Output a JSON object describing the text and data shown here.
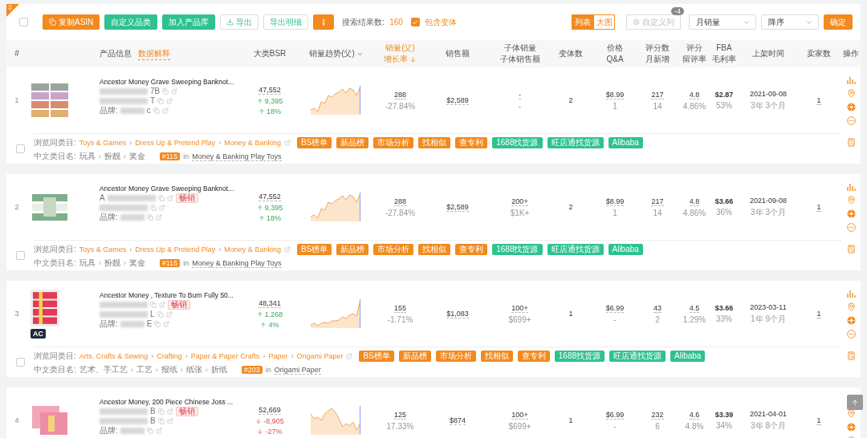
{
  "toolbar": {
    "select_all": {
      "checked": false
    },
    "buttons": [
      {
        "label": "复制ASIN",
        "kind": "primary"
      },
      {
        "label": "自定义品类",
        "kind": "success"
      },
      {
        "label": "加入产品库",
        "kind": "success"
      },
      {
        "label": "导出",
        "kind": "download"
      },
      {
        "label": "导出明细",
        "kind": "outline"
      }
    ],
    "more_button": "⋮",
    "result_label": "搜索结果数:",
    "result_count": "160",
    "include_variants": {
      "label": "包含变体",
      "checked": true
    },
    "view_tabs": [
      {
        "label": "列表",
        "selected": true
      },
      {
        "label": "大图",
        "selected": false
      }
    ],
    "custom_columns": {
      "label": "自定义列",
      "badge": "-4",
      "disabled": true
    },
    "sort_field": "月销量",
    "sort_order": "降序",
    "confirm": "确定"
  },
  "columns": [
    {
      "lines": [
        "#"
      ],
      "sorted": false,
      "kind": "plain"
    },
    {
      "lines": [
        "产品信息"
      ],
      "link": "数据解释",
      "sorted": false,
      "kind": "info"
    },
    {
      "lines": [
        "大类BSR"
      ],
      "sorted": false,
      "kind": "plain"
    },
    {
      "lines": [
        "销量趋势(父)"
      ],
      "sorted": false,
      "kind": "dropdown"
    },
    {
      "lines": [
        "销量(父)",
        "增长率"
      ],
      "sorted": true,
      "kind": "plain"
    },
    {
      "lines": [
        "销售额"
      ],
      "sorted": false,
      "kind": "plain"
    },
    {
      "lines": [
        "子体销量",
        "子体销售额"
      ],
      "sorted": false,
      "kind": "plain"
    },
    {
      "lines": [
        "变体数"
      ],
      "sorted": false,
      "kind": "plain"
    },
    {
      "lines": [
        "价格",
        "Q&A"
      ],
      "sorted": false,
      "kind": "plain"
    },
    {
      "lines": [
        "评分数",
        "月新增"
      ],
      "sorted": false,
      "kind": "plain"
    },
    {
      "lines": [
        "评分",
        "留评率"
      ],
      "sorted": false,
      "kind": "plain"
    },
    {
      "lines": [
        "FBA",
        "毛利率"
      ],
      "sorted": false,
      "kind": "plain"
    },
    {
      "lines": [
        "上架时间"
      ],
      "sorted": false,
      "kind": "plain"
    },
    {
      "lines": [
        "卖家数"
      ],
      "sorted": false,
      "kind": "plain"
    },
    {
      "lines": [
        "操作"
      ],
      "sorted": false,
      "kind": "plain"
    }
  ],
  "rows": [
    {
      "index": "1",
      "checked": false,
      "title": "Ancestor Money Grave Sweeping Banknot...",
      "asin": {
        "tail": "7B"
      },
      "parent": {
        "tail": "T"
      },
      "brand": {
        "label": "品牌:",
        "tail": "c"
      },
      "bsr": "47,552",
      "bsr_change": {
        "value": "9,395",
        "rising": true
      },
      "bsr_pct": {
        "value": "18%",
        "rising": true
      },
      "sales": {
        "main": "288",
        "sub": "-27.84%"
      },
      "amount": "$2,589",
      "child": {
        "main": "-",
        "sub": "-"
      },
      "variants": "2",
      "price": {
        "main": "$8.99",
        "sub": "1"
      },
      "ratings": {
        "main": "217",
        "sub": "14"
      },
      "rating": {
        "main": "4.8",
        "sub": "4.86%"
      },
      "fba": {
        "main": "$2.87",
        "sub": "53%"
      },
      "listed": {
        "main": "2021-09-08",
        "sub": "3年 3个月"
      },
      "sellers": "1",
      "category": {
        "label": "浏览同类目:",
        "path": [
          "Toys & Games",
          "Dress Up & Pretend Play",
          "Money & Banking"
        ],
        "separator": "›",
        "cn_label": "中文类目名:",
        "cn_path": [
          "玩具",
          "扮靓",
          "奖金"
        ],
        "rank": "#115",
        "in": "in",
        "node": "Money & Banking Play Toys"
      },
      "tags": [
        {
          "label": "BS榜单",
          "color": "#f28a1e"
        },
        {
          "label": "新品榜",
          "color": "#f28a1e"
        },
        {
          "label": "市场分析",
          "color": "#f28a1e"
        },
        {
          "label": "找相似",
          "color": "#f28a1e"
        },
        {
          "label": "查专利",
          "color": "#f28a1e"
        },
        {
          "label": "1688找货源",
          "color": "#2ec28e"
        },
        {
          "label": "旺店通找货源",
          "color": "#2ec28e"
        },
        {
          "label": "Alibaba",
          "color": "#2ec28e"
        }
      ]
    },
    {
      "index": "2",
      "checked": false,
      "title": "Ancestor Money Grave Sweeping Banknot...",
      "asin": {
        "head": "A",
        "badge": "畅销"
      },
      "parent": {},
      "brand": {
        "label": "品牌:"
      },
      "bsr": "47,552",
      "bsr_change": {
        "value": "9,395",
        "rising": true
      },
      "bsr_pct": {
        "value": "18%",
        "rising": true
      },
      "sales": {
        "main": "288",
        "sub": "-27.84%"
      },
      "amount": "$2,589",
      "child": {
        "main": "200+",
        "sub": "$1K+"
      },
      "variants": "2",
      "price": {
        "main": "$8.99",
        "sub": "1"
      },
      "ratings": {
        "main": "217",
        "sub": "14"
      },
      "rating": {
        "main": "4.8",
        "sub": "4.86%"
      },
      "fba": {
        "main": "$3.66",
        "sub": "36%"
      },
      "listed": {
        "main": "2021-09-08",
        "sub": "3年 3个月"
      },
      "sellers": "1",
      "category": {
        "label": "浏览同类目:",
        "path": [
          "Toys & Games",
          "Dress Up & Pretend Play",
          "Money & Banking"
        ],
        "separator": "›",
        "cn_label": "中文类目名:",
        "cn_path": [
          "玩具",
          "扮靓",
          "奖金"
        ],
        "rank": "#115",
        "in": "in",
        "node": "Money & Banking Play Toys"
      },
      "tags": [
        {
          "label": "BS榜单",
          "color": "#f28a1e"
        },
        {
          "label": "新品榜",
          "color": "#f28a1e"
        },
        {
          "label": "市场分析",
          "color": "#f28a1e"
        },
        {
          "label": "找相似",
          "color": "#f28a1e"
        },
        {
          "label": "查专利",
          "color": "#f28a1e"
        },
        {
          "label": "1688找货源",
          "color": "#2ec28e"
        },
        {
          "label": "旺店通找货源",
          "color": "#2ec28e"
        },
        {
          "label": "Alibaba",
          "color": "#2ec28e"
        }
      ]
    },
    {
      "index": "3",
      "checked": false,
      "title": "Ancestor Money , Texture To Burn Fully 50...",
      "ac_badge": "AC",
      "asin": {
        "badge": "畅销"
      },
      "parent": {
        "tail": "L"
      },
      "brand": {
        "label": "品牌:",
        "tail": "E"
      },
      "bsr": "48,341",
      "bsr_change": {
        "value": "1,268",
        "rising": true
      },
      "bsr_pct": {
        "value": "4%",
        "rising": true
      },
      "sales": {
        "main": "155",
        "sub": "-1.71%"
      },
      "amount": "$1,083",
      "child": {
        "main": "100+",
        "sub": "$699+"
      },
      "variants": "1",
      "price": {
        "main": "$6.99",
        "sub": "-"
      },
      "ratings": {
        "main": "43",
        "sub": "2"
      },
      "rating": {
        "main": "4.5",
        "sub": "1.29%"
      },
      "fba": {
        "main": "$3.66",
        "sub": "33%"
      },
      "listed": {
        "main": "2023-03-11",
        "sub": "1年 9个月"
      },
      "sellers": "1",
      "category": {
        "label": "浏览同类目:",
        "path": [
          "Arts, Crafts & Sewing",
          "Crafting",
          "Paper & Paper Crafts",
          "Paper",
          "Origami Paper"
        ],
        "separator": "›",
        "cn_label": "中文类目名:",
        "cn_path": [
          "艺术、手工艺",
          "工艺",
          "报纸",
          "纸张",
          "折纸"
        ],
        "rank": "#203",
        "in": "in",
        "node": "Origami Paper"
      },
      "tags": [
        {
          "label": "BS榜单",
          "color": "#f28a1e"
        },
        {
          "label": "新品榜",
          "color": "#f28a1e"
        },
        {
          "label": "市场分析",
          "color": "#f28a1e"
        },
        {
          "label": "找相似",
          "color": "#f28a1e"
        },
        {
          "label": "查专利",
          "color": "#f28a1e"
        },
        {
          "label": "1688找货源",
          "color": "#2ec28e"
        },
        {
          "label": "旺店通找货源",
          "color": "#2ec28e"
        },
        {
          "label": "Alibaba",
          "color": "#2ec28e"
        }
      ]
    },
    {
      "index": "4",
      "title": "Ancestor Money, 200 Piece Chinese Joss ...",
      "asin": {
        "tail": "B",
        "badge": "畅销"
      },
      "parent": {
        "tail": "B"
      },
      "brand": {
        "label": "品牌:"
      },
      "bsr": "52,669",
      "bsr_change": {
        "value": "-8,905",
        "rising": false
      },
      "bsr_pct": {
        "value": "-27%",
        "rising": false
      },
      "sales": {
        "main": "125",
        "sub": "17.33%"
      },
      "amount": "$874",
      "child": {
        "main": "100+",
        "sub": "$699+"
      },
      "variants": "1",
      "price": {
        "main": "$6.99",
        "sub": "-"
      },
      "ratings": {
        "main": "232",
        "sub": "6"
      },
      "rating": {
        "main": "4.6",
        "sub": "4.8%"
      },
      "fba": {
        "main": "$3.39",
        "sub": "34%"
      },
      "listed": {
        "main": "2021-04-01",
        "sub": "3年 8个月"
      },
      "sellers": "1"
    }
  ]
}
